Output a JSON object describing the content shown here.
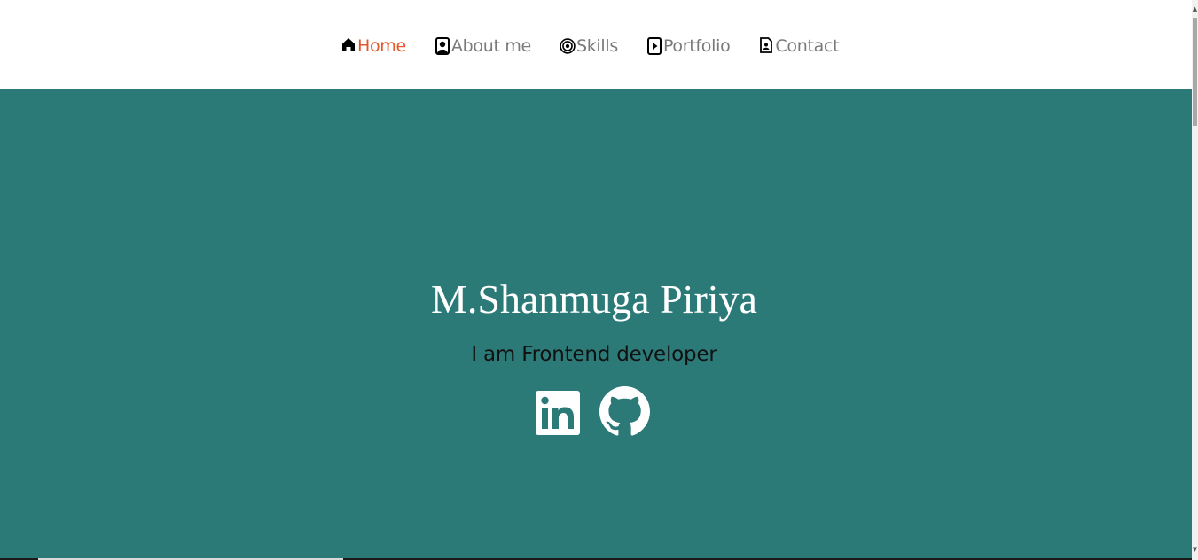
{
  "nav": {
    "items": [
      {
        "label": "Home",
        "icon": "home-icon",
        "active": true
      },
      {
        "label": "About me",
        "icon": "person-badge-icon",
        "active": false
      },
      {
        "label": "Skills",
        "icon": "target-icon",
        "active": false
      },
      {
        "label": "Portfolio",
        "icon": "file-play-icon",
        "active": false
      },
      {
        "label": "Contact",
        "icon": "file-person-icon",
        "active": false
      }
    ],
    "active_color": "#e2572b",
    "inactive_color": "#7a7a7a"
  },
  "hero": {
    "name": "M.Shanmuga Piriya",
    "subtitle": "I am Frontend developer",
    "background_color": "#2c7a78",
    "social": [
      {
        "icon": "linkedin-icon"
      },
      {
        "icon": "github-icon"
      }
    ]
  }
}
